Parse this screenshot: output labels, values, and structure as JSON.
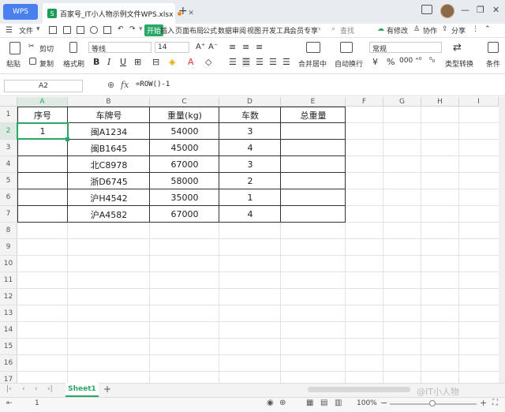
{
  "titlebar": {
    "app_tab": "WPS",
    "doc_tab": "百家号_IT小人物示例文件WPS.xlsx",
    "new_tab": "+"
  },
  "menu": {
    "file": "文件",
    "tabs": [
      "开始",
      "插入",
      "页面布局",
      "公式",
      "数据",
      "审阅",
      "视图",
      "开发工具",
      "会员专享"
    ],
    "search": "查找",
    "modified": "有修改",
    "collab": "协作",
    "share": "分享"
  },
  "toolbar": {
    "paste": "粘贴",
    "cut": "剪切",
    "copy": "复制",
    "format_painter": "格式刷",
    "font_name": "等线",
    "font_size": "14",
    "merge": "合并居中",
    "wrap": "自动换行",
    "number_format": "常规",
    "type_convert": "类型转换",
    "cond": "条件"
  },
  "formula_bar": {
    "cell_ref": "A2",
    "fx": "fx",
    "formula": "=ROW()-1"
  },
  "columns": [
    "A",
    "B",
    "C",
    "D",
    "E",
    "F",
    "G",
    "H",
    "I"
  ],
  "rows": [
    "1",
    "2",
    "3",
    "4",
    "5",
    "6",
    "7",
    "8",
    "9",
    "10",
    "11",
    "12",
    "13",
    "14",
    "15",
    "16",
    "17"
  ],
  "table": {
    "headers": [
      "序号",
      "车牌号",
      "重量(kg)",
      "车数",
      "总重量"
    ],
    "rows": [
      [
        "1",
        "闽A1234",
        "54000",
        "3",
        ""
      ],
      [
        "",
        "闽B1645",
        "45000",
        "4",
        ""
      ],
      [
        "",
        "北C8978",
        "67000",
        "3",
        ""
      ],
      [
        "",
        "浙D6745",
        "58000",
        "2",
        ""
      ],
      [
        "",
        "沪H4542",
        "35000",
        "1",
        ""
      ],
      [
        "",
        "沪A4582",
        "67000",
        "4",
        ""
      ]
    ]
  },
  "sheet_tab": "Sheet1",
  "status": {
    "count": "1",
    "zoom": "100%",
    "watermark": "@IT小人物"
  },
  "colors": {
    "accent": "#2aa865",
    "wps_blue": "#4a7ff0"
  }
}
